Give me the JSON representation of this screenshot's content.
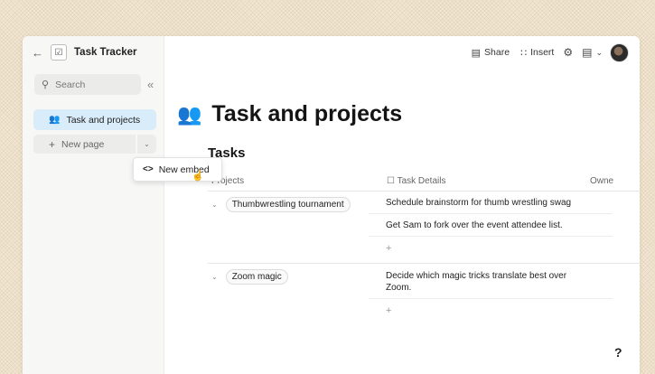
{
  "app": {
    "title": "Task Tracker"
  },
  "sidebar": {
    "search_label": "Search",
    "pages": [
      {
        "label": "Task and projects",
        "icon": "people-icon"
      }
    ],
    "new_page_label": "New page",
    "menu": {
      "item": "New embed"
    }
  },
  "toolbar": {
    "share": "Share",
    "insert": "Insert"
  },
  "page": {
    "title": "Task and projects",
    "section": "Tasks"
  },
  "table": {
    "columns": [
      "Projects",
      "Task Details",
      "Owne"
    ],
    "groups": [
      {
        "project": "Thumbwrestling tournament",
        "tasks": [
          "Schedule brainstorm for thumb wrestling swag",
          "Get Sam to fork over the event attendee list."
        ]
      },
      {
        "project": "Zoom magic",
        "tasks": [
          "Decide which magic tricks translate best over Zoom."
        ]
      }
    ],
    "add_label": "+"
  },
  "help": "?"
}
